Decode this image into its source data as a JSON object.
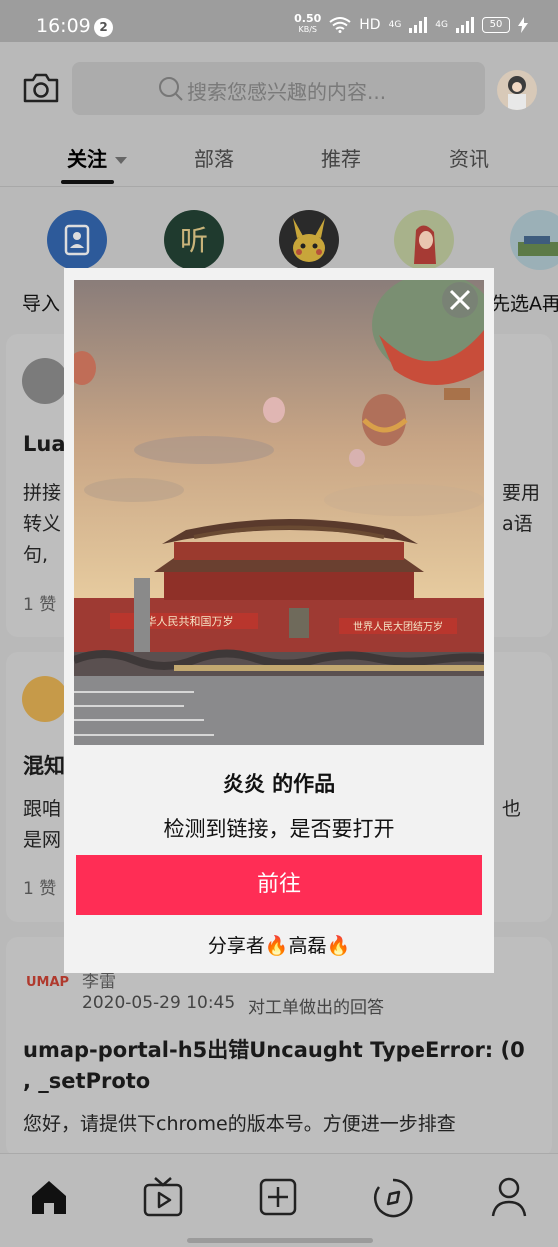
{
  "status_bar": {
    "time": "16:09",
    "notification_count": "2",
    "net_speed_top": "0.50",
    "net_speed_unit": "KB/S",
    "hd": "HD",
    "net1": "4G",
    "net2": "4G",
    "battery": "50"
  },
  "search": {
    "placeholder": "搜索您感兴趣的内容..."
  },
  "tabs": [
    {
      "label": "关注"
    },
    {
      "label": "部落"
    },
    {
      "label": "推荐"
    },
    {
      "label": "资讯"
    }
  ],
  "contacts": {
    "left_label": "导入",
    "right_label": "先选A再"
  },
  "cards": [
    {
      "title_fragment": "Lua",
      "lines": [
        "拼接",
        "转义",
        "句,"
      ],
      "right_lines": [
        "要用",
        "a语"
      ],
      "likes": "1 赞"
    },
    {
      "title_fragment": "混知",
      "lines": [
        "跟咱",
        "是网"
      ],
      "right_lines": [
        "也"
      ],
      "likes": "1 赞"
    },
    {
      "brand": "UMAP",
      "author": "李雷",
      "date": "2020-05-29 10:45",
      "action": "对工单做出的回答",
      "title": "umap-portal-h5出错Uncaught TypeError: (0 , _setProto",
      "body": "您好，请提供下chrome的版本号。方便进一步排查"
    }
  ],
  "modal": {
    "title": "炎炎 的作品",
    "message": "检测到链接，是否要打开",
    "button": "前往",
    "sharer": "分享者🔥高磊🔥",
    "banner_left": "中华人民共和国万岁",
    "banner_right": "世界人民大团结万岁"
  },
  "colors": {
    "accent": "#ff2d55",
    "overlay": "#b9b9b9"
  }
}
